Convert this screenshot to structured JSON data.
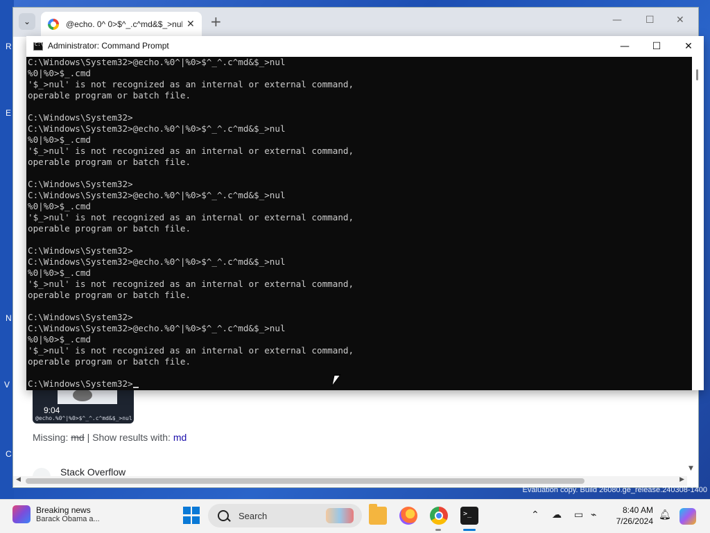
{
  "desktop_peek": [
    "R",
    "E",
    "N",
    "V",
    "C"
  ],
  "browser": {
    "tab_title": "@echo. 0^ 0>$^_.c^md&$_>nul",
    "tab_close": "✕",
    "new_tab": "+",
    "dropdown": "⌄",
    "minimize": "—",
    "maximize": "☐",
    "close": "✕",
    "video_duration": "9:04",
    "video_caption": "@echo.%0^|%0>$^_^.c^md&$_>nul",
    "missing_label": "Missing:",
    "missing_term": "md",
    "show_results_label": "| Show results with:",
    "show_results_term": "md",
    "result_source": "Stack Overflow"
  },
  "cmd": {
    "title": "Administrator: Command Prompt",
    "minimize": "—",
    "maximize": "☐",
    "close": "✕",
    "lines": [
      "C:\\Windows\\System32>@echo.%0^|%0>$^_^.c^md&$_>nul",
      "%0|%0>$_.cmd",
      "'$_>nul' is not recognized as an internal or external command,",
      "operable program or batch file.",
      "",
      "C:\\Windows\\System32>",
      "C:\\Windows\\System32>@echo.%0^|%0>$^_^.c^md&$_>nul",
      "%0|%0>$_.cmd",
      "'$_>nul' is not recognized as an internal or external command,",
      "operable program or batch file.",
      "",
      "C:\\Windows\\System32>",
      "C:\\Windows\\System32>@echo.%0^|%0>$^_^.c^md&$_>nul",
      "%0|%0>$_.cmd",
      "'$_>nul' is not recognized as an internal or external command,",
      "operable program or batch file.",
      "",
      "C:\\Windows\\System32>",
      "C:\\Windows\\System32>@echo.%0^|%0>$^_^.c^md&$_>nul",
      "%0|%0>$_.cmd",
      "'$_>nul' is not recognized as an internal or external command,",
      "operable program or batch file.",
      "",
      "C:\\Windows\\System32>",
      "C:\\Windows\\System32>@echo.%0^|%0>$^_^.c^md&$_>nul",
      "%0|%0>$_.cmd",
      "'$_>nul' is not recognized as an internal or external command,",
      "operable program or batch file.",
      "",
      "C:\\Windows\\System32>"
    ]
  },
  "evaluation_text": "Evaluation copy. Build 26080.ge_release.240308-1400",
  "taskbar": {
    "news_title": "Breaking news",
    "news_subtitle": "Barack Obama a...",
    "search_label": "Search",
    "tray_chevron": "⌃",
    "time": "8:40 AM",
    "date": "7/26/2024",
    "accent_color": "#0a79d6",
    "icons": [
      "start-icon",
      "search-icon",
      "file-explorer-icon",
      "firefox-icon",
      "chrome-icon",
      "terminal-icon",
      "onedrive-icon",
      "display-icon",
      "network-icon",
      "volume-icon",
      "notification-bell-icon",
      "copilot-icon"
    ]
  }
}
